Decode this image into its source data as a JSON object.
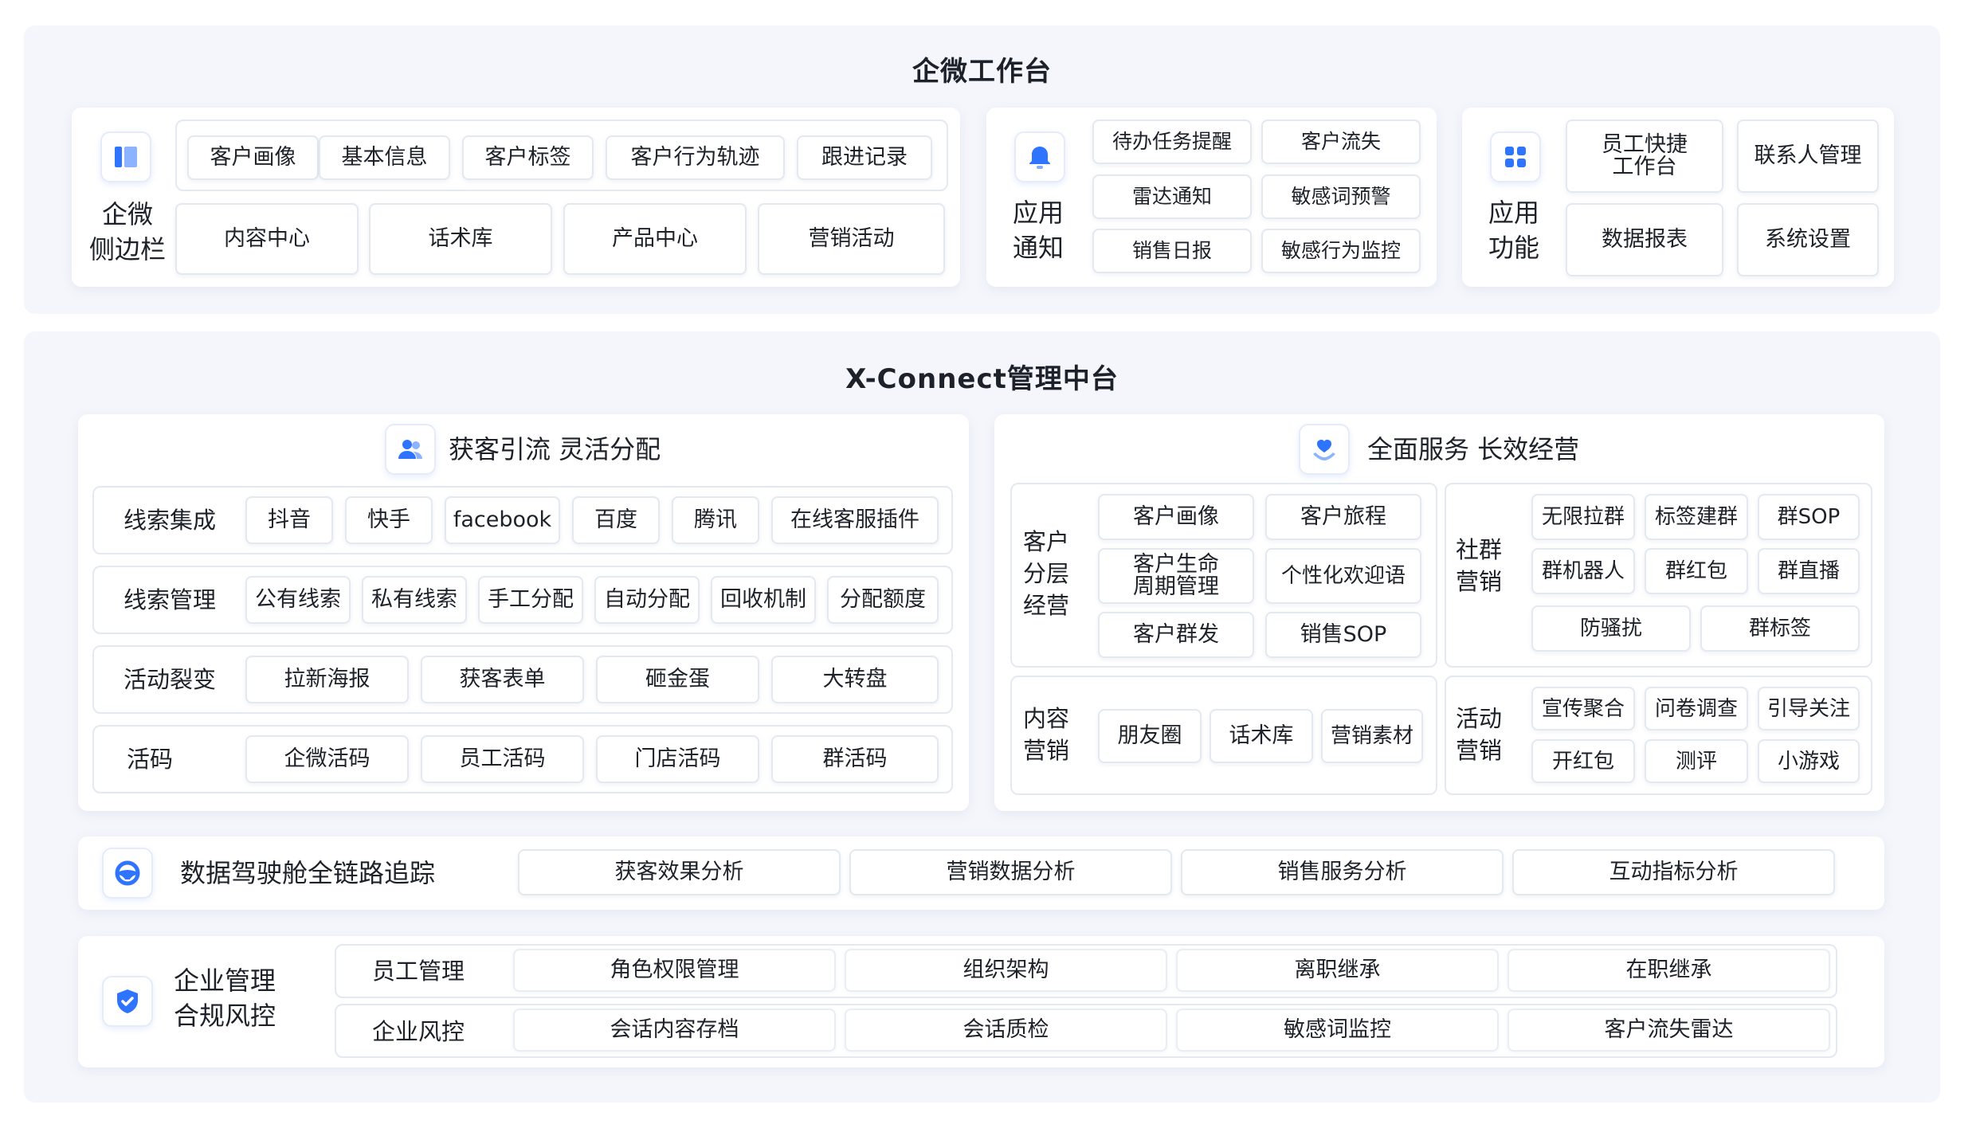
{
  "colors": {
    "accent": "#2e74ff",
    "section_bg": "#f4f6fb",
    "card_bg": "#ffffff",
    "border": "#e3e8f1",
    "text": "#1d2129"
  },
  "top": {
    "title": "企微工作台",
    "sidebar": {
      "icon": "sidebar-icon",
      "label": "企微\n侧边栏",
      "row1": [
        "客户画像",
        "基本信息",
        "客户标签",
        "客户行为轨迹",
        "跟进记录"
      ],
      "row2": [
        "内容中心",
        "话术库",
        "产品中心",
        "营销活动"
      ]
    },
    "notify": {
      "icon": "bell-icon",
      "label": "应用\n通知",
      "items": [
        "待办任务提醒",
        "客户流失",
        "雷达通知",
        "敏感词预警",
        "销售日报",
        "敏感行为监控"
      ]
    },
    "func": {
      "icon": "grid-icon",
      "label": "应用\n功能",
      "items": [
        "员工快捷\n工作台",
        "联系人管理",
        "数据报表",
        "系统设置"
      ]
    }
  },
  "mid": {
    "title": "X-Connect管理中台",
    "left": {
      "icon": "users-icon",
      "title": "获客引流 灵活分配",
      "rows": [
        {
          "label": "线索集成",
          "items": [
            "抖音",
            "快手",
            "facebook",
            "百度",
            "腾讯",
            "在线客服插件"
          ]
        },
        {
          "label": "线索管理",
          "items": [
            "公有线索",
            "私有线索",
            "手工分配",
            "自动分配",
            "回收机制",
            "分配额度"
          ]
        },
        {
          "label": "活动裂变",
          "items": [
            "拉新海报",
            "获客表单",
            "砸金蛋",
            "大转盘"
          ]
        },
        {
          "label": "活码",
          "items": [
            "企微活码",
            "员工活码",
            "门店活码",
            "群活码"
          ]
        }
      ]
    },
    "right": {
      "icon": "heart-hand-icon",
      "title": "全面服务 长效经营",
      "layer": {
        "label": "客户\n分层\n经营",
        "items": [
          "客户画像",
          "客户旅程",
          "客户生命\n周期管理",
          "个性化欢迎语",
          "客户群发",
          "销售SOP"
        ]
      },
      "group": {
        "label": "社群\n营销",
        "items": [
          "无限拉群",
          "标签建群",
          "群SOP",
          "群机器人",
          "群红包",
          "群直播",
          "防骚扰",
          "群标签"
        ]
      },
      "content": {
        "label": "内容\n营销",
        "items": [
          "朋友圈",
          "话术库",
          "营销素材"
        ]
      },
      "activity": {
        "label": "活动\n营销",
        "items": [
          "宣传聚合",
          "问卷调查",
          "引导关注",
          "开红包",
          "测评",
          "小游戏"
        ]
      }
    },
    "data": {
      "icon": "steering-wheel-icon",
      "title": "数据驾驶舱全链路追踪",
      "items": [
        "获客效果分析",
        "营销数据分析",
        "销售服务分析",
        "互动指标分析"
      ]
    },
    "mgmt": {
      "icon": "shield-check-icon",
      "title": "企业管理\n合规风控",
      "rows": [
        {
          "label": "员工管理",
          "items": [
            "角色权限管理",
            "组织架构",
            "离职继承",
            "在职继承"
          ]
        },
        {
          "label": "企业风控",
          "items": [
            "会话内容存档",
            "会话质检",
            "敏感词监控",
            "客户流失雷达"
          ]
        }
      ]
    }
  }
}
